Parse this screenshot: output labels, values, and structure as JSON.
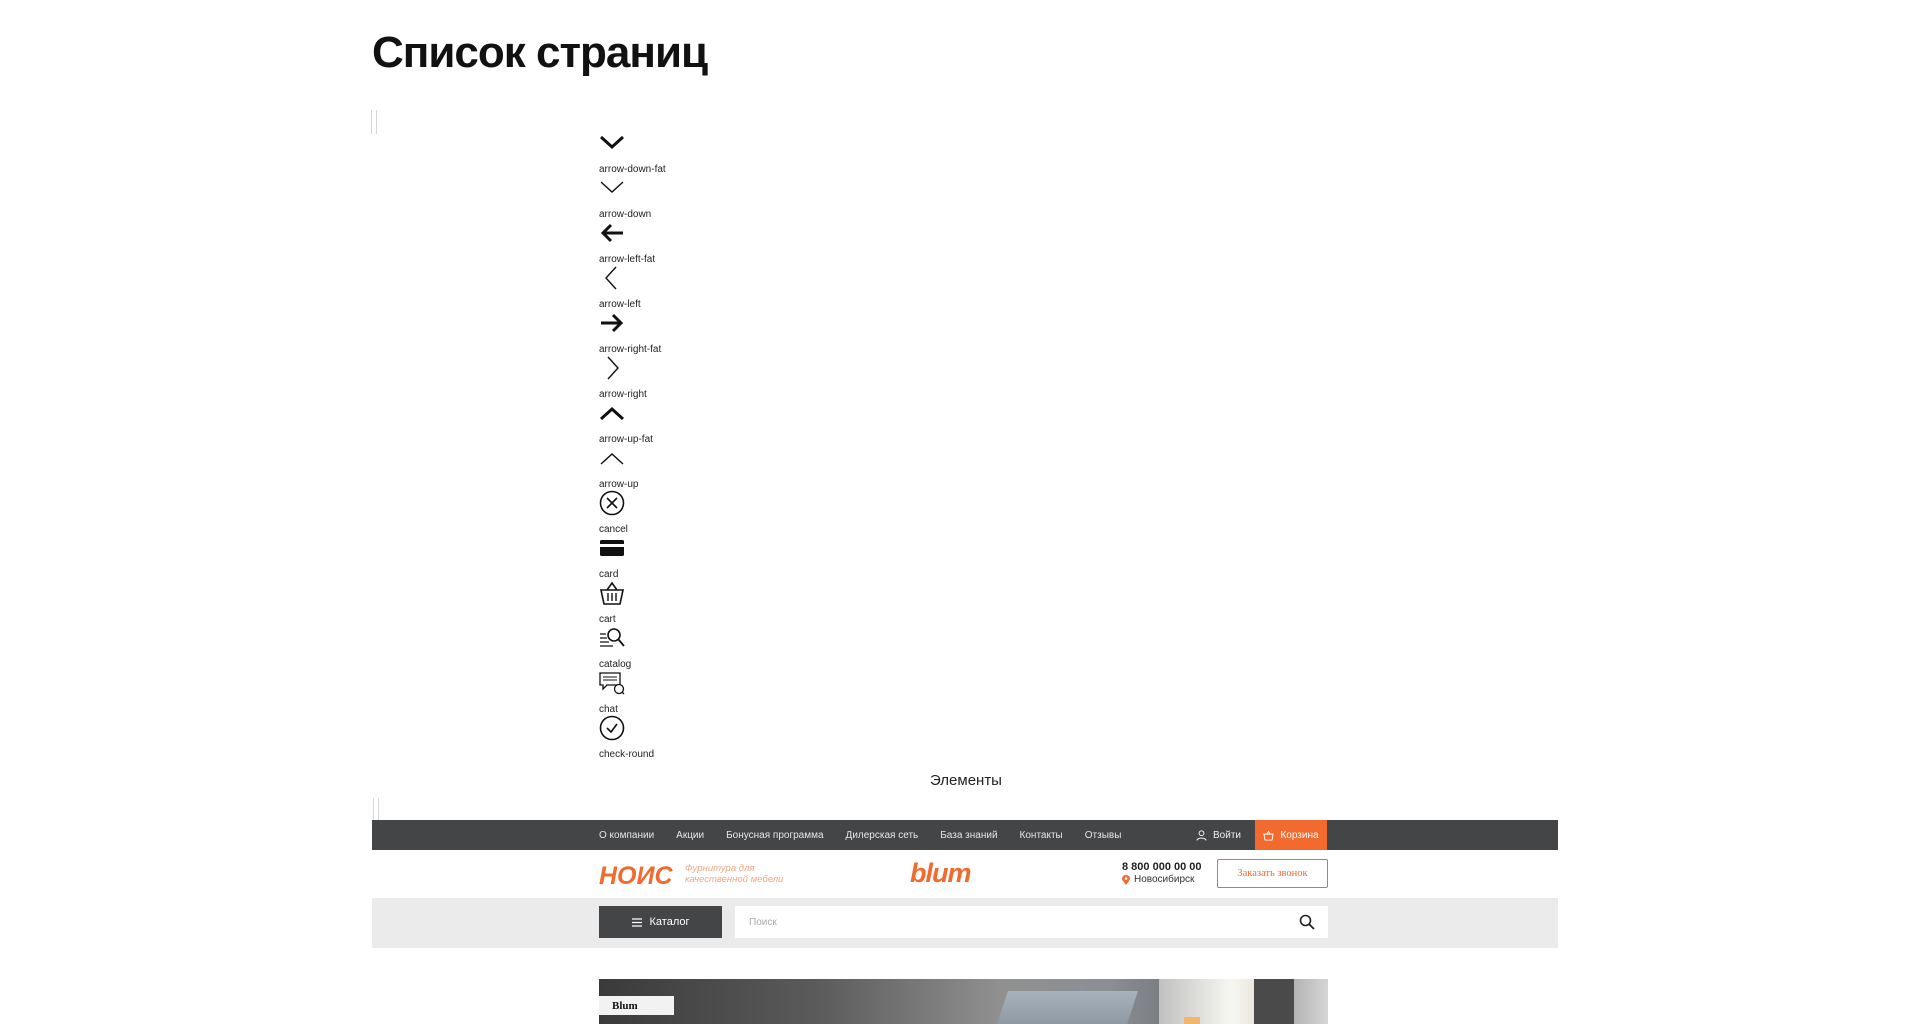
{
  "page": {
    "title": "Список страниц"
  },
  "icons": [
    {
      "label": "arrow-down-fat"
    },
    {
      "label": "arrow-down"
    },
    {
      "label": "arrow-left-fat"
    },
    {
      "label": "arrow-left"
    },
    {
      "label": "arrow-right-fat"
    },
    {
      "label": "arrow-right"
    },
    {
      "label": "arrow-up-fat"
    },
    {
      "label": "arrow-up"
    },
    {
      "label": "cancel"
    },
    {
      "label": "card"
    },
    {
      "label": "cart"
    },
    {
      "label": "catalog"
    },
    {
      "label": "chat"
    },
    {
      "label": "check-round"
    }
  ],
  "section": {
    "label": "Элементы"
  },
  "site": {
    "nav": [
      "О компании",
      "Акции",
      "Бонусная программа",
      "Дилерская сеть",
      "База знаний",
      "Контакты",
      "Отзывы"
    ],
    "login_label": "Войти",
    "cart_label": "Корзина",
    "logo_text": "НОИС",
    "logo_tagline": "Фурнитура для качественной мебели",
    "partner_logo": "blum",
    "phone": "8 800 000 00 00",
    "city": "Новосибирск",
    "callback_label": "Заказать звонок",
    "catalog_label": "Каталог",
    "search_placeholder": "Поиск",
    "banner_tag": "Blum"
  },
  "colors": {
    "accent": "#f26a2e",
    "dark_bar": "#444546",
    "search_bg": "#ebebeb"
  }
}
